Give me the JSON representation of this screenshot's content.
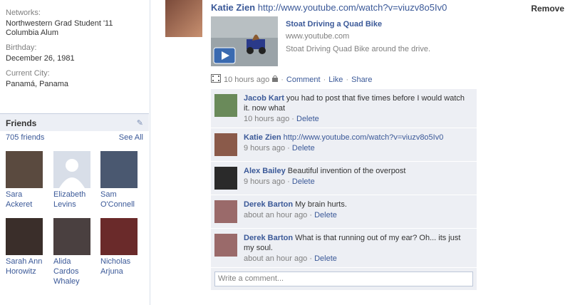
{
  "sidebar": {
    "info": [
      {
        "label": "Networks:",
        "value": "Northwestern Grad Student '11\nColumbia Alum"
      },
      {
        "label": "Birthday:",
        "value": "December 26, 1981"
      },
      {
        "label": "Current City:",
        "value": "Panamá, Panama"
      }
    ],
    "friends_title": "Friends",
    "friends_count": "705 friends",
    "see_all": "See All",
    "friends": [
      {
        "name": "Sara Ackeret",
        "color": "#5a4a3f"
      },
      {
        "name": "Elizabeth Levins",
        "color": "#d8dee8"
      },
      {
        "name": "Sam O'Connell",
        "color": "#4a5870"
      },
      {
        "name": "Sarah Ann Horowitz",
        "color": "#3a2e2a"
      },
      {
        "name": "Alida Cardos Whaley",
        "color": "#4a4040"
      },
      {
        "name": "Nicholas Arjuna",
        "color": "#6a2a2a"
      }
    ]
  },
  "post": {
    "author": "Katie Zien",
    "link": "http://www.youtube.com/watch?v=viuzv8o5Iv0",
    "remove": "Remove",
    "video_title": "Stoat Driving a Quad Bike",
    "video_domain": "www.youtube.com",
    "video_desc": "Stoat Driving Quad Bike around the drive.",
    "time": "10 hours ago",
    "actions": [
      "Comment",
      "Like",
      "Share"
    ]
  },
  "comments": [
    {
      "name": "Jacob Kart",
      "text": "you had to post that five times before I would watch it. now what",
      "time": "10 hours ago",
      "delete": "Delete",
      "color": "#6a8a5a"
    },
    {
      "name": "Katie Zien",
      "text": "http://www.youtube.com/watch?v=viuzv8o5Iv0",
      "time": "9 hours ago",
      "delete": "Delete",
      "color": "#8a5a4a"
    },
    {
      "name": "Alex Bailey",
      "text": "Beautiful invention of the overpost",
      "time": "9 hours ago",
      "delete": "Delete",
      "color": "#2a2a2a"
    },
    {
      "name": "Derek Barton",
      "text": "My brain hurts.",
      "time": "about an hour ago",
      "delete": "Delete",
      "color": "#9a6a6a"
    },
    {
      "name": "Derek Barton",
      "text": "What is that running out of my ear? Oh... its just my soul.",
      "time": "about an hour ago",
      "delete": "Delete",
      "color": "#9a6a6a"
    }
  ],
  "write_comment": "Write a comment..."
}
